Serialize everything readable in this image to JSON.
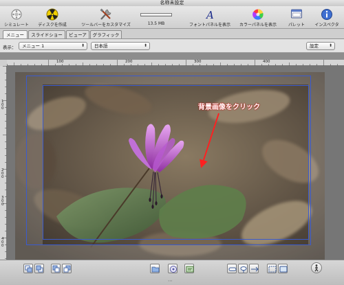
{
  "window": {
    "title": "名称未設定"
  },
  "toolbar": {
    "simulate": "シミュレート",
    "burn": "ディスクを作成",
    "customize": "ツールバーをカスタマイズ",
    "size": "13.5 MB",
    "fonts": "フォントパネルを表示",
    "colors": "カラーパネルを表示",
    "palette": "パレット",
    "inspector": "インスペクタ"
  },
  "tabs": [
    "メニュー",
    "スライドショー",
    "ビューア",
    "グラフィック"
  ],
  "options": {
    "display_label": "表示：",
    "menu_value": "メニュー 1",
    "language_value": "日本語",
    "settings_label": "設定"
  },
  "ruler": {
    "h_ticks": [
      "100",
      "200",
      "300",
      "400"
    ],
    "v_ticks": [
      "1 0 0",
      "2 0 0",
      "3 0 0",
      "4 0 0"
    ]
  },
  "canvas": {
    "callout": "背景画像をクリック",
    "accent": "#ff2020",
    "frame_color": "#3a5bd0"
  }
}
